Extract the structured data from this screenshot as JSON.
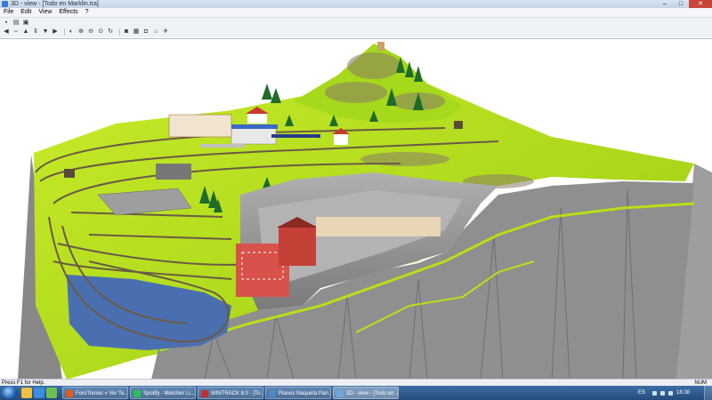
{
  "window": {
    "title": "3D - view - [Todo en Marklin.tra]"
  },
  "menu": [
    "File",
    "Edit",
    "View",
    "Effects",
    "?"
  ],
  "toolbar": {
    "row1": [
      "save-icon",
      "print-icon",
      "print-preview-icon"
    ],
    "row2": [
      "arrow-left-icon",
      "arrow-left-right-icon",
      "arrow-up-icon",
      "arrow-up-down-icon",
      "arrow-down-icon",
      "arrow-right-icon",
      "view-icon",
      "zoom-in-icon",
      "zoom-out-icon",
      "zoom-fit-icon",
      "rotate-icon",
      "camera-icon",
      "texture-icon",
      "train-icon",
      "walk-icon",
      "fly-icon"
    ]
  },
  "status": {
    "help": "Press F1 for Help.",
    "num": "NUM"
  },
  "taskbar": {
    "items": [
      {
        "label": "ForoTrenes » Ver Te...",
        "color": "#e05a1e"
      },
      {
        "label": "Spotify - Melchior Li...",
        "color": "#2ebd59"
      },
      {
        "label": "WINTRACK 8.0 - [To...",
        "color": "#c03030"
      },
      {
        "label": "Planos Maqueta Parr...",
        "color": "#4a86c8"
      },
      {
        "label": "3D - view - [Todo en ...",
        "color": "#6fa8dc"
      }
    ],
    "lang": "ES",
    "clock": "18:38"
  },
  "colors": {
    "terrain": "#b7e017",
    "cliff": "#9a9a9a",
    "water": "#4a6fb0",
    "track": "#6b5a45"
  }
}
